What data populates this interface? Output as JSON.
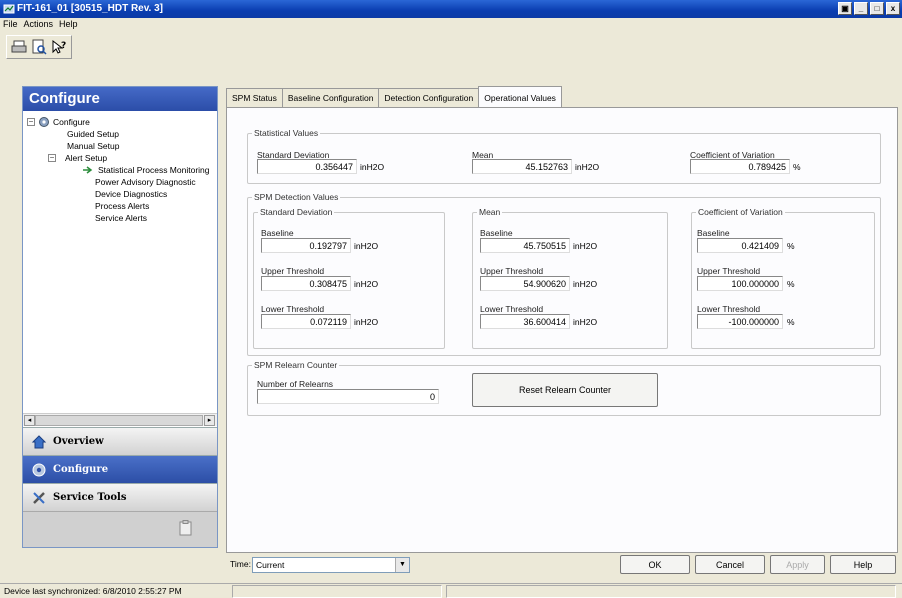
{
  "window": {
    "title": "FIT-161_01 [30515_HDT Rev. 3]"
  },
  "menu": [
    "File",
    "Actions",
    "Help"
  ],
  "left_pane": {
    "header": "Configure",
    "tree": {
      "root": "Configure",
      "guided": "Guided Setup",
      "manual": "Manual Setup",
      "alert": "Alert Setup",
      "spm": "Statistical Process Monitoring",
      "power": "Power Advisory Diagnostic",
      "device": "Device Diagnostics",
      "process": "Process Alerts",
      "service": "Service Alerts"
    },
    "nav": {
      "overview": "Overview",
      "configure": "Configure",
      "service_tools": "Service Tools"
    }
  },
  "tabs": [
    "SPM Status",
    "Baseline Configuration",
    "Detection Configuration",
    "Operational Values"
  ],
  "statistical_values": {
    "legend": "Statistical Values",
    "std_label": "Standard Deviation",
    "std_value": "0.356447",
    "std_unit": "inH2O",
    "mean_label": "Mean",
    "mean_value": "45.152763",
    "mean_unit": "inH2O",
    "cov_label": "Coefficient of Variation",
    "cov_value": "0.789425",
    "cov_unit": "%"
  },
  "spm_detection": {
    "legend": "SPM Detection Values",
    "std": {
      "legend": "Standard Deviation",
      "baseline_label": "Baseline",
      "baseline": "0.192797",
      "upper_label": "Upper Threshold",
      "upper": "0.308475",
      "lower_label": "Lower Threshold",
      "lower": "0.072119",
      "unit": "inH2O"
    },
    "mean": {
      "legend": "Mean",
      "baseline_label": "Baseline",
      "baseline": "45.750515",
      "upper_label": "Upper Threshold",
      "upper": "54.900620",
      "lower_label": "Lower Threshold",
      "lower": "36.600414",
      "unit": "inH2O"
    },
    "cov": {
      "legend": "Coefficient of Variation",
      "baseline_label": "Baseline",
      "baseline": "0.421409",
      "upper_label": "Upper Threshold",
      "upper": "100.000000",
      "lower_label": "Lower Threshold",
      "lower": "-100.000000",
      "unit": "%"
    }
  },
  "relearn": {
    "legend": "SPM Relearn Counter",
    "count_label": "Number of Relearns",
    "count": "0",
    "reset_button": "Reset Relearn Counter"
  },
  "bottom": {
    "time_label": "Time:",
    "time_value": "Current",
    "ok": "OK",
    "cancel": "Cancel",
    "apply": "Apply",
    "help": "Help"
  },
  "status": "Device last synchronized: 6/8/2010 2:55:27 PM",
  "colors": {
    "titlebar": "#0a3db0",
    "selected_nav": "#2c4ea6"
  }
}
